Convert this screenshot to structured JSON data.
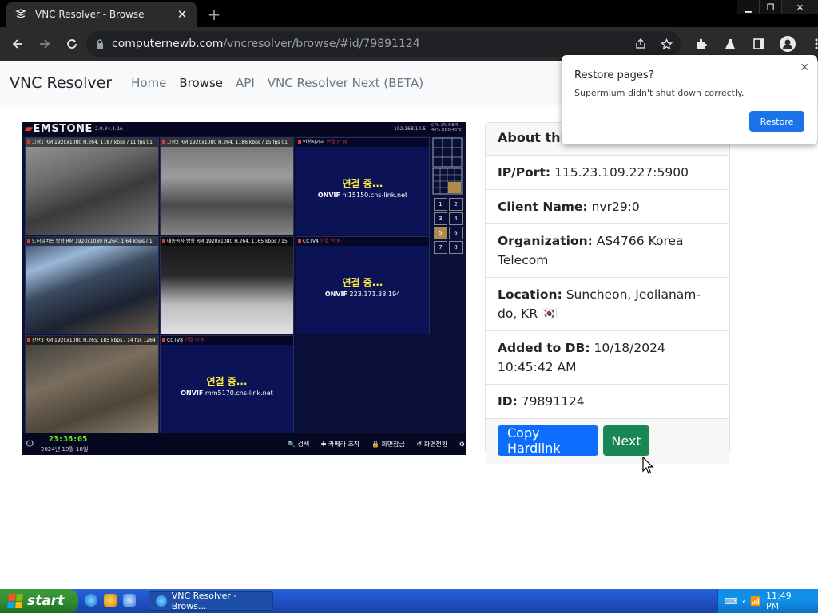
{
  "browser": {
    "tab_title": "VNC Resolver - Browse",
    "url_host": "computernewb.com",
    "url_path": "/vncresolver/browse/#id/79891124"
  },
  "site": {
    "brand": "VNC Resolver",
    "nav": [
      "Home",
      "Browse",
      "API",
      "VNC Resolver Next (BETA)"
    ],
    "active_nav": "Browse"
  },
  "popup": {
    "title": "Restore pages?",
    "body": "Supermium didn't shut down correctly.",
    "button": "Restore"
  },
  "vnc_screen": {
    "logo": "EMSTONE",
    "version": "2.0.34.4.2A",
    "ip": "192.168.10.5",
    "stats": "CPU 2%  MEM 46%  HDD 46°C",
    "cams": [
      {
        "label": "고정1",
        "info": "RM 1920x1080 H.264, 1187 kbps / 11 fps 01"
      },
      {
        "label": "고정2",
        "info": "RM 1920x1080 H.264, 1186 kbps / 15 fps 01"
      },
      {
        "label": "인천사거리",
        "info": "연결 안 됨",
        "connecting": "연결 중...",
        "onvif": "hi15150.cns-link.net"
      },
      {
        "label": "5.터널버프 방향",
        "info": "RM 1920x1080 H.264, 1.64 kbps / 1"
      },
      {
        "label": "매동동사 방향",
        "info": "RM 1920x1080 H.264, 1165 kbps / 15"
      },
      {
        "label": "CCTV4",
        "info": "연결 안 됨",
        "connecting": "연결 중...",
        "onvif": "223.171.38.194"
      },
      {
        "label": "산단3",
        "info": "RM 1920x1080 H.265, 185 kbps / 14 fps 1264"
      },
      {
        "label": "CCTV8",
        "info": "연결 안 됨",
        "connecting": "연결 중...",
        "onvif": "mm5170.cns-link.net"
      }
    ],
    "onvif_prefix": "ONVIF",
    "side_numbers": [
      "1",
      "2",
      "3",
      "4",
      "5",
      "6",
      "7",
      "8"
    ],
    "time": "23:36:05",
    "date": "2024년 10월 18일",
    "menu": [
      "검색",
      "카메라 조작",
      "화면잠금",
      "화면전환",
      "설정"
    ]
  },
  "about": {
    "header": "About this VNC",
    "rows": [
      {
        "label": "IP/Port:",
        "value": "115.23.109.227:5900"
      },
      {
        "label": "Client Name:",
        "value": "nvr29:0"
      },
      {
        "label": "Organization:",
        "value": "AS4766 Korea Telecom"
      },
      {
        "label": "Location:",
        "value": "Suncheon, Jeollanam-do, KR 🇰🇷"
      },
      {
        "label": "Added to DB:",
        "value": "10/18/2024 10:45:42 AM"
      },
      {
        "label": "ID:",
        "value": "79891124"
      }
    ],
    "copy_button": "Copy Hardlink",
    "next_button": "Next"
  },
  "taskbar": {
    "start": "start",
    "task_title": "VNC Resolver - Brows...",
    "clock": "11:49 PM"
  },
  "colors": {
    "primary": "#0d6efd",
    "success": "#198754",
    "chrome_dark": "#2b2b2b",
    "xp_blue": "#245edb"
  }
}
